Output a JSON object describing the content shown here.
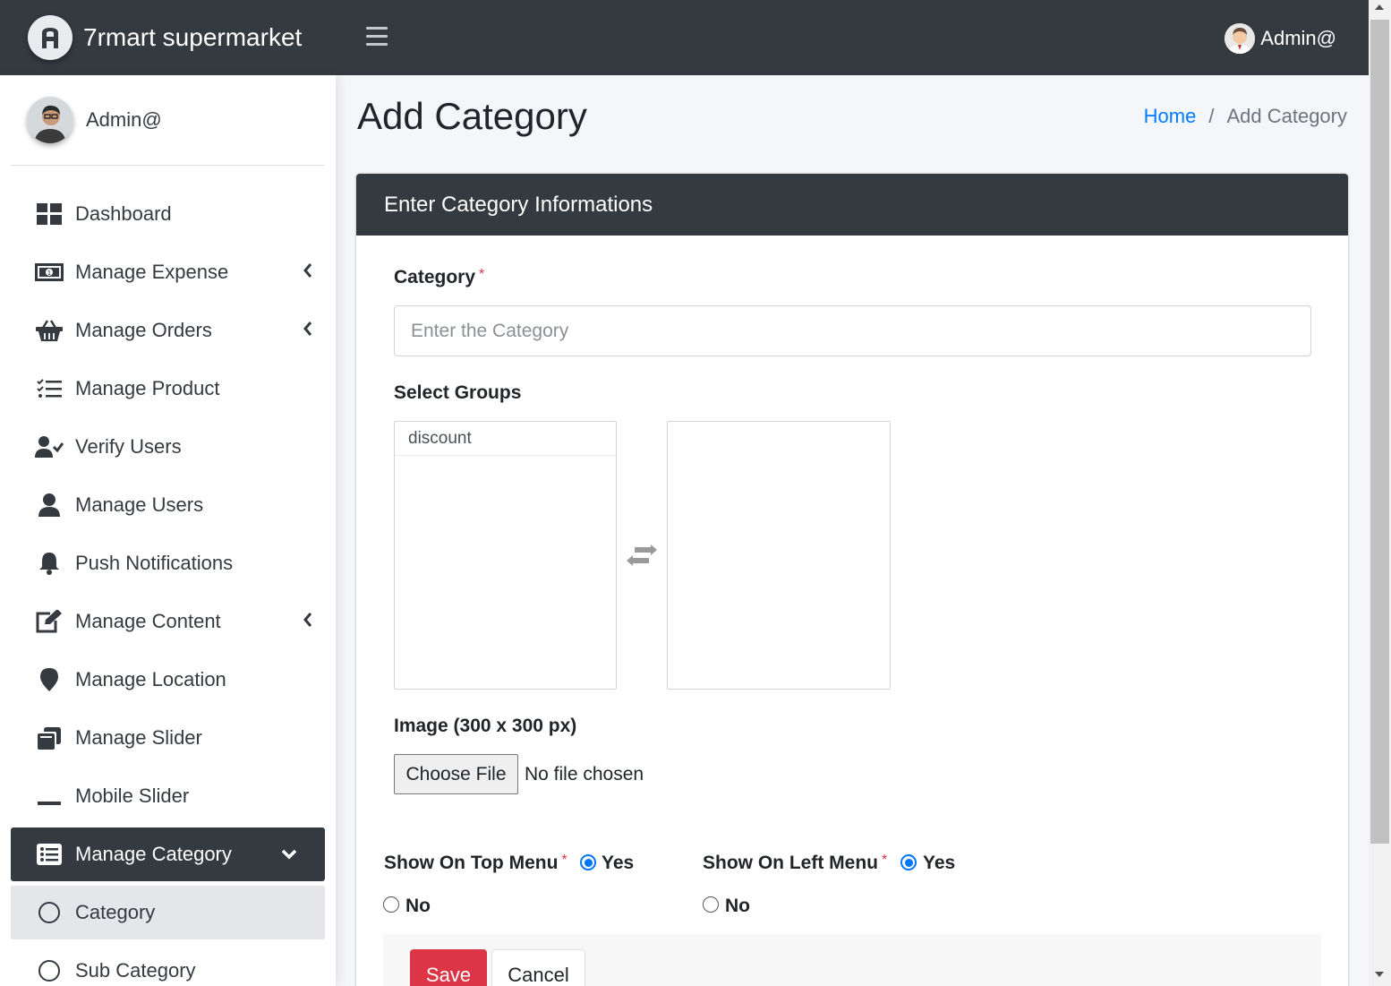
{
  "app": {
    "brand": "7rmart supermarket"
  },
  "topbar": {
    "user": "Admin@"
  },
  "sidebar": {
    "user_name": "Admin@",
    "items": [
      {
        "label": "Dashboard",
        "icon": "dashboard-icon"
      },
      {
        "label": "Manage Expense",
        "icon": "money-icon"
      },
      {
        "label": "Manage Orders",
        "icon": "basket-icon"
      },
      {
        "label": "Manage Product",
        "icon": "list-check-icon"
      },
      {
        "label": "Verify Users",
        "icon": "user-check-icon"
      },
      {
        "label": "Manage Users",
        "icon": "user-icon"
      },
      {
        "label": "Push Notifications",
        "icon": "bell-icon"
      },
      {
        "label": "Manage Content",
        "icon": "edit-icon"
      },
      {
        "label": "Manage Location",
        "icon": "map-marker-icon"
      },
      {
        "label": "Manage Slider",
        "icon": "copy-icon"
      },
      {
        "label": "Mobile Slider",
        "icon": "minus-icon"
      },
      {
        "label": "Manage Category",
        "icon": "list-alt-icon"
      },
      {
        "label": "Category",
        "icon": "circle-icon"
      },
      {
        "label": "Sub Category",
        "icon": "circle-icon"
      }
    ]
  },
  "page": {
    "title": "Add Category",
    "breadcrumb": {
      "home": "Home",
      "separator": "/",
      "current": "Add Category"
    }
  },
  "form": {
    "card_title": "Enter Category Informations",
    "category_label": "Category",
    "required_mark": "*",
    "category_placeholder": "Enter the Category",
    "groups_label": "Select Groups",
    "groups_available": [
      "discount"
    ],
    "groups_selected": [],
    "image_label": "Image (300 x 300 px)",
    "file_button": "Choose File",
    "file_status": "No file chosen",
    "top_menu_label": "Show On Top Menu",
    "left_menu_label": "Show On Left Menu",
    "yes": "Yes",
    "no": "No",
    "top_menu_value": "Yes",
    "left_menu_value": "Yes",
    "save": "Save",
    "cancel": "Cancel"
  },
  "colors": {
    "dark": "#343a40",
    "primary": "#007bff",
    "danger": "#dc3545",
    "radio": "#0075ff"
  }
}
